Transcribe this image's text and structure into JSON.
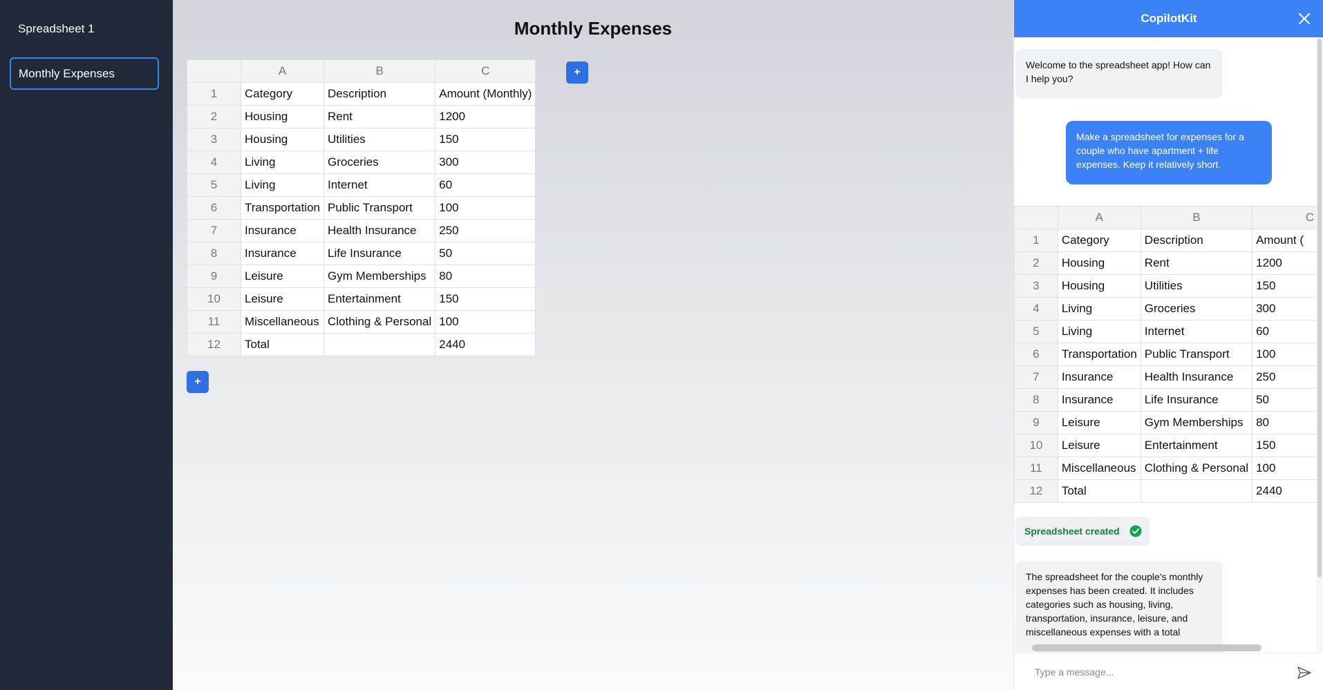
{
  "sidebar": {
    "title": "Spreadsheet 1",
    "items": [
      {
        "label": "Monthly Expenses"
      }
    ]
  },
  "main": {
    "title": "Monthly Expenses",
    "add_column_label": "+",
    "add_row_label": "+",
    "table": {
      "columns": [
        "A",
        "B",
        "C"
      ],
      "rows": [
        {
          "num": "1",
          "cells": [
            "Category",
            "Description",
            "Amount (Monthly)"
          ]
        },
        {
          "num": "2",
          "cells": [
            "Housing",
            "Rent",
            "1200"
          ]
        },
        {
          "num": "3",
          "cells": [
            "Housing",
            "Utilities",
            "150"
          ]
        },
        {
          "num": "4",
          "cells": [
            "Living",
            "Groceries",
            "300"
          ]
        },
        {
          "num": "5",
          "cells": [
            "Living",
            "Internet",
            "60"
          ]
        },
        {
          "num": "6",
          "cells": [
            "Transportation",
            "Public Transport",
            "100"
          ]
        },
        {
          "num": "7",
          "cells": [
            "Insurance",
            "Health Insurance",
            "250"
          ]
        },
        {
          "num": "8",
          "cells": [
            "Insurance",
            "Life Insurance",
            "50"
          ]
        },
        {
          "num": "9",
          "cells": [
            "Leisure",
            "Gym Memberships",
            "80"
          ]
        },
        {
          "num": "10",
          "cells": [
            "Leisure",
            "Entertainment",
            "150"
          ]
        },
        {
          "num": "11",
          "cells": [
            "Miscellaneous",
            "Clothing & Personal",
            "100"
          ]
        },
        {
          "num": "12",
          "cells": [
            "Total",
            "",
            "2440"
          ]
        }
      ]
    }
  },
  "copilot": {
    "title": "CopilotKit",
    "messages": {
      "welcome": "Welcome to the spreadsheet app! How can I help you?",
      "user_request": "Make a spreadsheet for expenses for a couple who have apartment + life expenses. Keep it relatively short.",
      "result": "The spreadsheet for the couple's monthly expenses has been created. It includes categories such as housing, living, transportation, insurance, leisure, and miscellaneous expenses with a total"
    },
    "status_chip": "Spreadsheet created",
    "input_placeholder": "Type a message...",
    "table": {
      "columns": [
        "A",
        "B",
        "C"
      ],
      "rows": [
        {
          "num": "1",
          "cells": [
            "Category",
            "Description",
            "Amount ("
          ]
        },
        {
          "num": "2",
          "cells": [
            "Housing",
            "Rent",
            "1200"
          ]
        },
        {
          "num": "3",
          "cells": [
            "Housing",
            "Utilities",
            "150"
          ]
        },
        {
          "num": "4",
          "cells": [
            "Living",
            "Groceries",
            "300"
          ]
        },
        {
          "num": "5",
          "cells": [
            "Living",
            "Internet",
            "60"
          ]
        },
        {
          "num": "6",
          "cells": [
            "Transportation",
            "Public Transport",
            "100"
          ]
        },
        {
          "num": "7",
          "cells": [
            "Insurance",
            "Health Insurance",
            "250"
          ]
        },
        {
          "num": "8",
          "cells": [
            "Insurance",
            "Life Insurance",
            "50"
          ]
        },
        {
          "num": "9",
          "cells": [
            "Leisure",
            "Gym Memberships",
            "80"
          ]
        },
        {
          "num": "10",
          "cells": [
            "Leisure",
            "Entertainment",
            "150"
          ]
        },
        {
          "num": "11",
          "cells": [
            "Miscellaneous",
            "Clothing & Personal",
            "100"
          ]
        },
        {
          "num": "12",
          "cells": [
            "Total",
            "",
            "2440"
          ]
        }
      ]
    }
  },
  "colors": {
    "sidebar_bg": "#1f2937",
    "accent": "#3b82f6",
    "button": "#2f6fe0",
    "success": "#15803d"
  }
}
